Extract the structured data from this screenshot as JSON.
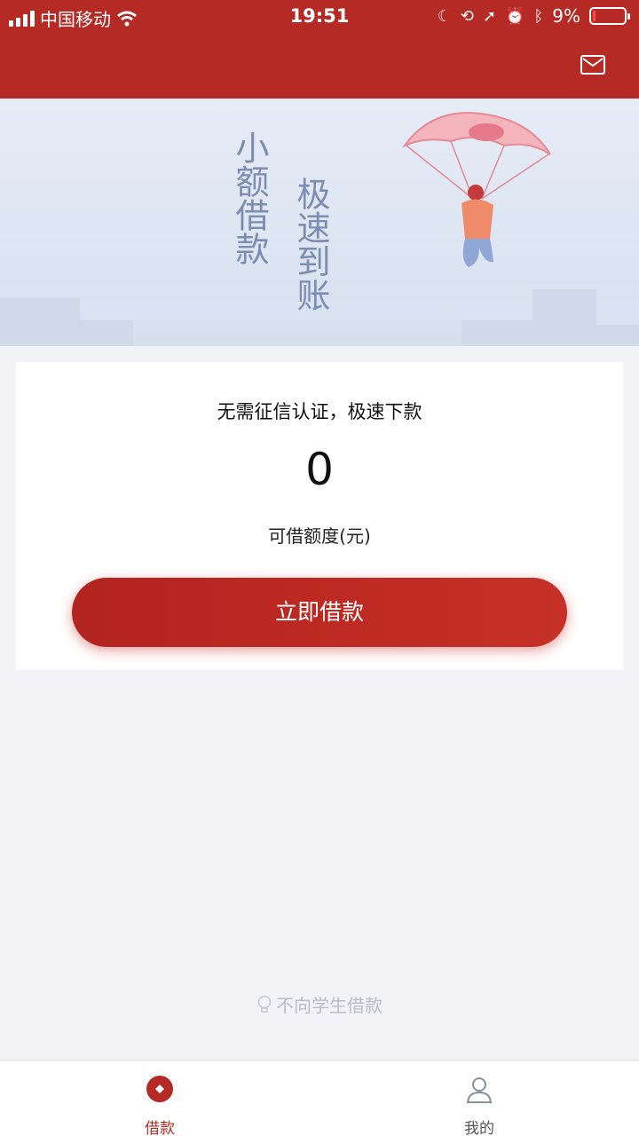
{
  "status_bar": {
    "carrier": "中国移动",
    "time": "19:51",
    "battery": "9%",
    "battery_level": 0.09
  },
  "header": {
    "mail_icon": "mail-icon"
  },
  "banner": {
    "line1": "小额借款",
    "line2": "极速到账"
  },
  "card": {
    "tagline": "无需征信认证，极速下款",
    "amount": "0",
    "amount_label": "可借额度(元)",
    "button_label": "立即借款"
  },
  "footer_note": "不向学生借款",
  "tabs": [
    {
      "label": "借款",
      "icon": "coin-icon",
      "active": true
    },
    {
      "label": "我的",
      "icon": "user-icon",
      "active": false
    }
  ],
  "colors": {
    "brand": "#b52a25",
    "banner_text": "#7d8cb1",
    "note_text": "#b8bcc6"
  }
}
